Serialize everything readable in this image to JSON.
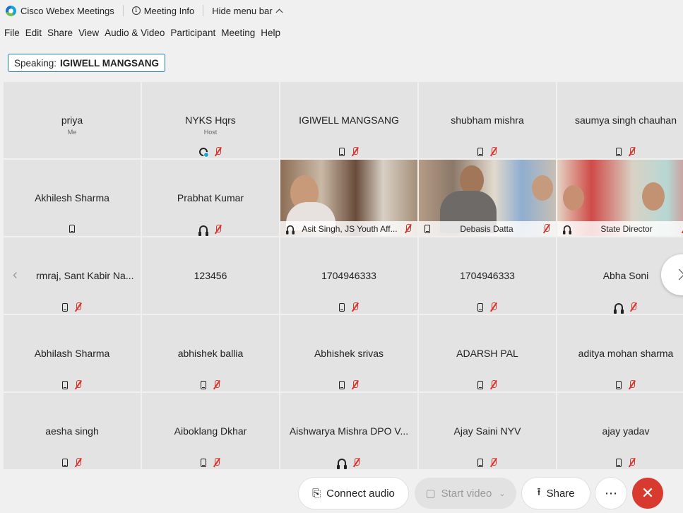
{
  "titlebar": {
    "app_name": "Cisco Webex Meetings",
    "meeting_info": "Meeting Info",
    "hide_menu": "Hide menu bar"
  },
  "menu": [
    "File",
    "Edit",
    "Share",
    "View",
    "Audio & Video",
    "Participant",
    "Meeting",
    "Help"
  ],
  "speaking": {
    "label": "Speaking:",
    "name": "IGIWELL MANGSANG"
  },
  "tiles": [
    {
      "name": "priya",
      "sub": "Me"
    },
    {
      "name": "NYKS Hqrs",
      "sub": "Host"
    },
    {
      "name": "IGIWELL MANGSANG"
    },
    {
      "name": "shubham mishra"
    },
    {
      "name": "saumya singh chauhan"
    },
    {
      "name": "Akhilesh Sharma"
    },
    {
      "name": "Prabhat Kumar"
    },
    {
      "name": "Asit Singh, JS Youth Aff..."
    },
    {
      "name": "Debasis Datta"
    },
    {
      "name": "State Director"
    },
    {
      "name": "rmraj, Sant Kabir Na..."
    },
    {
      "name": "123456"
    },
    {
      "name": "1704946333"
    },
    {
      "name": "1704946333"
    },
    {
      "name": "Abha Soni"
    },
    {
      "name": "Abhilash Sharma"
    },
    {
      "name": "abhishek ballia"
    },
    {
      "name": "Abhishek srivas"
    },
    {
      "name": "ADARSH PAL"
    },
    {
      "name": "aditya mohan sharma"
    },
    {
      "name": "aesha singh"
    },
    {
      "name": "Aiboklang Dkhar"
    },
    {
      "name": "Aishwarya Mishra DPO V..."
    },
    {
      "name": "Ajay Saini NYV"
    },
    {
      "name": "ajay yadav"
    }
  ],
  "controls": {
    "connect_audio": "Connect audio",
    "start_video": "Start video",
    "share": "Share",
    "more": "⋯",
    "end": "✕"
  },
  "colors": {
    "mute_red": "#d9342b",
    "end_red": "#d93a2f",
    "accent_blue": "#1a78c2"
  }
}
